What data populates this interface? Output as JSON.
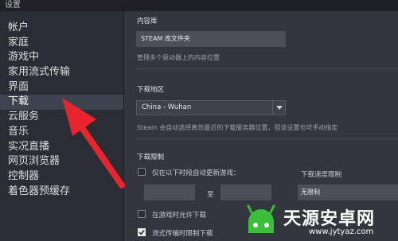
{
  "window": {
    "title": "设置"
  },
  "sidebar": {
    "items": [
      {
        "label": "帐户"
      },
      {
        "label": "家庭"
      },
      {
        "label": "游戏中"
      },
      {
        "label": "家用流式传输"
      },
      {
        "label": "界面"
      },
      {
        "label": "下载",
        "active": true
      },
      {
        "label": "云服务"
      },
      {
        "label": "音乐"
      },
      {
        "label": "实况直播"
      },
      {
        "label": "网页浏览器"
      },
      {
        "label": "控制器"
      },
      {
        "label": "着色器预缓存"
      }
    ]
  },
  "content_library": {
    "heading": "内容库",
    "button_label": "STEAM 库文件夹",
    "description": "管理多个驱动器上的内容位置"
  },
  "download_region": {
    "heading": "下载地区",
    "selected": "China - Wuhan",
    "description": "Steam 会自动选择离您最近的下载服务器位置，但该设置也可手动指定"
  },
  "download_restrictions": {
    "heading": "下载限制",
    "time_limit_label": "仅在以下时段自动更新游戏：",
    "time_limit_checked": false,
    "to_label": "至",
    "speed_limit_label": "下载速度限制",
    "speed_limit_value": "无限制",
    "allow_in_game_label": "在游戏时允许下载",
    "allow_in_game_checked": false,
    "throttle_streaming_label": "流式传输时限制下载",
    "throttle_streaming_checked": true
  },
  "watermark": {
    "brand": "天源安卓网",
    "url": "www.jytyaz.com"
  },
  "colors": {
    "arrow": "#e8242f",
    "accent": "#1a9fff",
    "watermark_green": "#3bbf3b"
  }
}
